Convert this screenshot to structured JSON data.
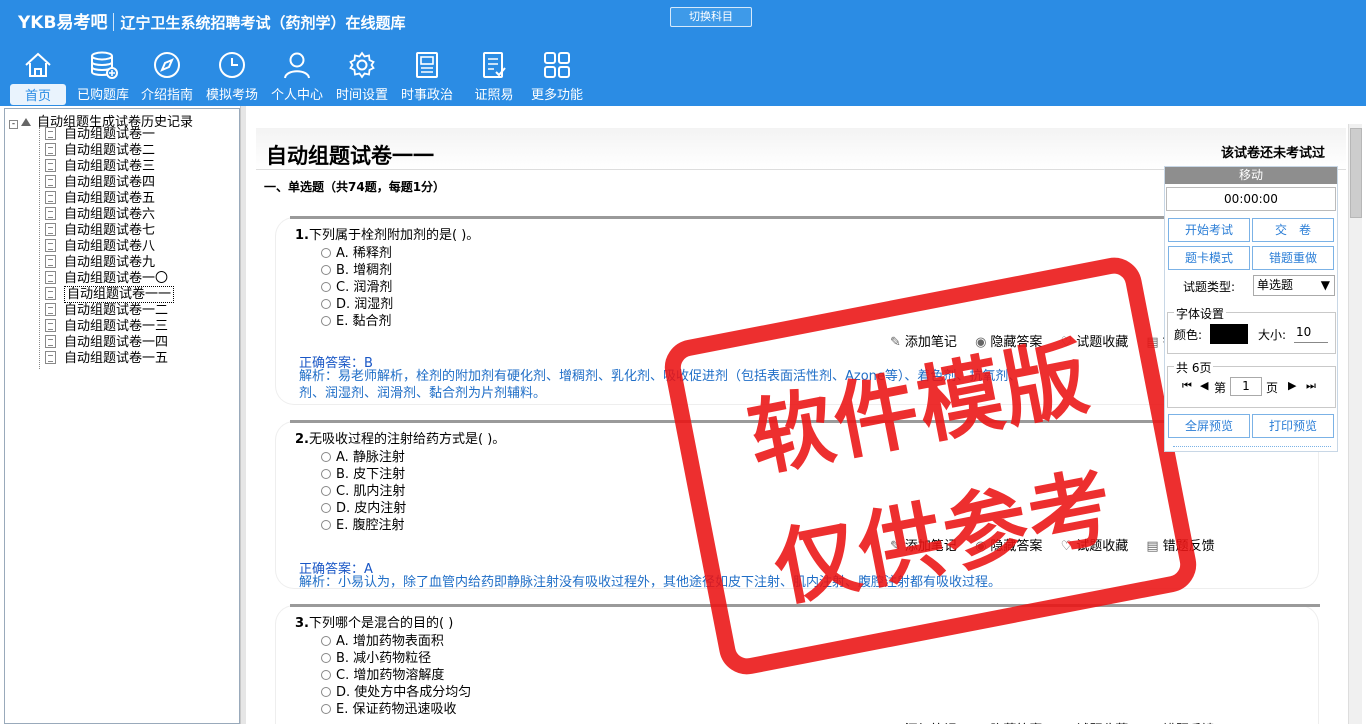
{
  "header": {
    "logo": "YKB易考吧",
    "title": "辽宁卫生系统招聘考试（药剂学）在线题库",
    "switch_subject": "切换科目"
  },
  "nav": [
    {
      "label": "首页",
      "icon": "home-icon"
    },
    {
      "label": "已购题库",
      "icon": "database-icon"
    },
    {
      "label": "介绍指南",
      "icon": "compass-icon"
    },
    {
      "label": "模拟考场",
      "icon": "clock-icon"
    },
    {
      "label": "个人中心",
      "icon": "user-icon"
    },
    {
      "label": "时间设置",
      "icon": "gear-icon"
    },
    {
      "label": "时事政治",
      "icon": "newspaper-icon"
    },
    {
      "label": "证照易",
      "icon": "checklist-icon"
    },
    {
      "label": "更多功能",
      "icon": "grid-icon"
    }
  ],
  "tree": {
    "root": "自动组题生成试卷历史记录",
    "items": [
      "自动组题试卷一",
      "自动组题试卷二",
      "自动组题试卷三",
      "自动组题试卷四",
      "自动组题试卷五",
      "自动组题试卷六",
      "自动组题试卷七",
      "自动组题试卷八",
      "自动组题试卷九",
      "自动组题试卷一〇",
      "自动组题试卷一一",
      "自动组题试卷一二",
      "自动组题试卷一三",
      "自动组题试卷一四",
      "自动组题试卷一五"
    ],
    "selected": "自动组题试卷一一"
  },
  "paper": {
    "title": "自动组题试卷一一",
    "status": "该试卷还未考试过",
    "section": "一、单选题（共74题，每题1分）"
  },
  "questions": [
    {
      "number": "1.",
      "stem": "下列属于栓剂附加剂的是( )。",
      "options": [
        "A. 稀释剂",
        "B. 增稠剂",
        "C. 润滑剂",
        "D. 润湿剂",
        "E. 黏合剂"
      ],
      "answer": "正确答案：B",
      "analysis_1": "解析：易老师解析，栓剂的附加剂有硬化剂、增稠剂、乳化剂、吸收促进剂（包括表面活性剂、Azone等）、着色剂、抗氧剂、",
      "analysis_2": "剂、润湿剂、润滑剂、黏合剂为片剂辅料。"
    },
    {
      "number": "2.",
      "stem": "无吸收过程的注射给药方式是( )。",
      "options": [
        "A. 静脉注射",
        "B. 皮下注射",
        "C. 肌内注射",
        "D. 皮内注射",
        "E. 腹腔注射"
      ],
      "answer": "正确答案：A",
      "analysis_1": "解析：小易认为，除了血管内给药即静脉注射没有吸收过程外，其他途径如皮下注射、肌内注射、腹腔注射都有吸收过程。"
    },
    {
      "number": "3.",
      "stem": "下列哪个是混合的目的( )",
      "options": [
        "A. 增加药物表面积",
        "B. 减小药物粒径",
        "C. 增加药物溶解度",
        "D. 使处方中各成分均匀",
        "E. 保证药物迅速吸收"
      ]
    }
  ],
  "actions": {
    "add_note": "添加笔记",
    "hide_answer": "隐藏答案",
    "favorite": "试题收藏",
    "report_error": "错题反馈"
  },
  "panel": {
    "move": "移动",
    "timer": "00:00:00",
    "start_exam": "开始考试",
    "submit": "交　卷",
    "card_mode": "题卡模式",
    "redo_wrong": "错题重做",
    "type_label": "试题类型:",
    "type_value": "单选题",
    "font_settings": "字体设置",
    "color_label": "颜色:",
    "size_label": "大小:",
    "size_value": "10",
    "color_value": "#000000",
    "pages_total": "共 6页",
    "page_prefix": "第",
    "page_value": "1",
    "page_suffix": "页",
    "fullscreen": "全屏预览",
    "print": "打印预览"
  },
  "watermark": {
    "line1": "软件模版",
    "line2": "仅供参考"
  }
}
